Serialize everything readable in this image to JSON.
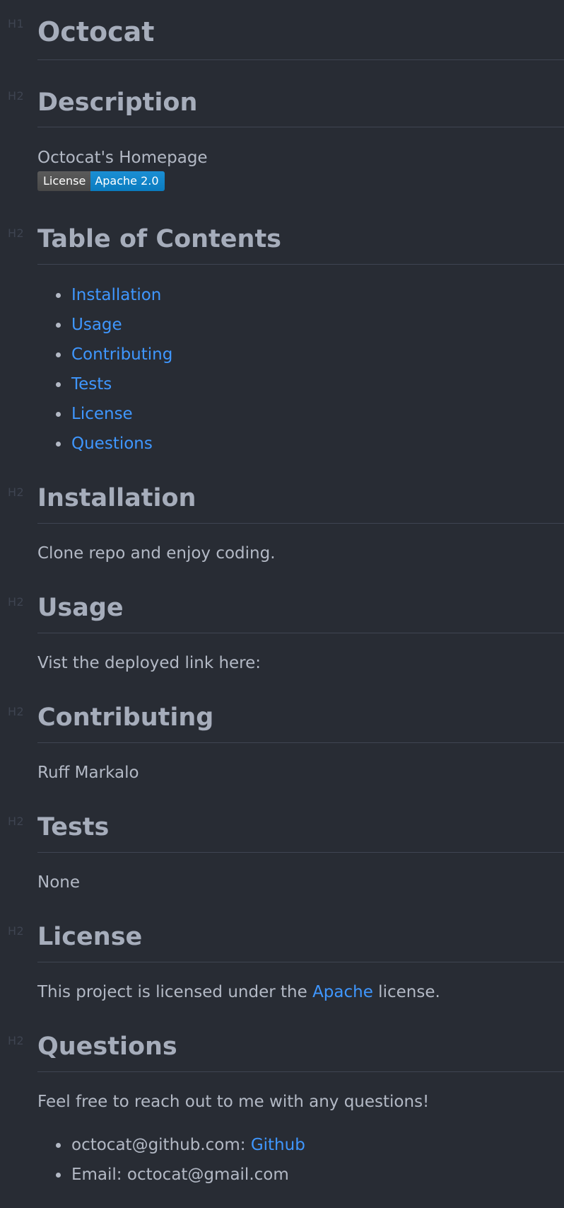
{
  "document": {
    "h1_marker": "H1",
    "h2_marker": "H2",
    "title": "Octocat",
    "description": {
      "heading": "Description",
      "text": "Octocat's Homepage",
      "badge": {
        "label": "License",
        "value": "Apache 2.0",
        "label_color": "#555555",
        "value_color": "#007ec6"
      }
    },
    "toc": {
      "heading": "Table of Contents",
      "items": [
        "Installation",
        "Usage",
        "Contributing",
        "Tests",
        "License",
        "Questions"
      ]
    },
    "installation": {
      "heading": "Installation",
      "text": "Clone repo and enjoy coding."
    },
    "usage": {
      "heading": "Usage",
      "text": "Vist the deployed link here:"
    },
    "contributing": {
      "heading": "Contributing",
      "text": "Ruff Markalo"
    },
    "tests": {
      "heading": "Tests",
      "text": "None"
    },
    "license": {
      "heading": "License",
      "text_before": "This project is licensed under the ",
      "link_text": "Apache",
      "text_after": " license."
    },
    "questions": {
      "heading": "Questions",
      "text": "Feel free to reach out to me with any questions!",
      "github_prefix": "octocat@github.com: ",
      "github_link": "Github",
      "email_line": "Email: octocat@gmail.com"
    }
  },
  "colors": {
    "background": "#282c34",
    "heading": "#a6adbb",
    "text": "#b3b9c5",
    "link": "#3f97ff",
    "rule": "#3f4552"
  }
}
